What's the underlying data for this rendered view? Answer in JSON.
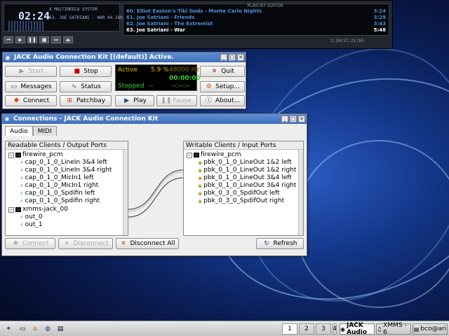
{
  "xmms": {
    "time": "02:24",
    "ticker": "X MULTIMEDIA SYSTEM",
    "info": "63. JOE SATRIANI - WAR   44.1kHz",
    "playlist_header": "PLAYLIST EDITOR",
    "tracks": [
      {
        "title": "60. Elliot Easton's Tiki Gods - Monte Carlo Nights",
        "time": "3:24"
      },
      {
        "title": "61. Joe Satriani - Friends",
        "time": "3:29"
      },
      {
        "title": "62. Joe Satriani - The Extremist",
        "time": "3:43"
      },
      {
        "title": "63. Joe Satriani - War",
        "time": "5:48"
      }
    ],
    "footer": "2:24/17:21:55"
  },
  "jack": {
    "title": "JACK Audio Connection Kit [(default)] Active.",
    "buttons": {
      "start": "Start",
      "stop": "Stop",
      "quit": "Quit",
      "messages": "Messages",
      "status": "Status",
      "setup": "Setup...",
      "connect": "Connect",
      "patchbay": "Patchbay",
      "play": "Play",
      "pause": "Pause",
      "about": "About..."
    },
    "status": {
      "state": "Active",
      "load": "5.9 %",
      "rate": "48000 Hz",
      "time": "00:00:00",
      "transport": "Stopped",
      "dash1": "--",
      "dash2": "--:--:--"
    }
  },
  "connections": {
    "title": "Connections - JACK Audio Connection Kit",
    "tabs": [
      "Audio",
      "MIDI"
    ],
    "readable_header": "Readable Clients / Output Ports",
    "writable_header": "Writable Clients / Input Ports",
    "readable": {
      "client1": "firewire_pcm",
      "ports1": [
        "cap_0_1_0_LineIn 3&4 left",
        "cap_0_1_0_LineIn 3&4 right",
        "cap_0_1_0_MicIn1 left",
        "cap_0_1_0_MicIn1 right",
        "cap_0_1_0_Spdifin left",
        "cap_0_1_0_Spdifin right"
      ],
      "client2": "xmms-jack_00",
      "ports2": [
        "out_0",
        "out_1"
      ]
    },
    "writable": {
      "client1": "firewire_pcm",
      "ports1": [
        "pbk_0_1_0_LineOut 1&2 left",
        "pbk_0_1_0_LineOut 1&2 right",
        "pbk_0_1_0_LineOut 3&4 left",
        "pbk_0_1_0_LineOut 3&4 right",
        "pbk_0_3_0_SpdifOut left",
        "pbk_0_3_0_SpdifOut right"
      ]
    },
    "buttons": {
      "connect": "Connect",
      "disconnect": "Disconnect",
      "disconnect_all": "Disconnect All",
      "refresh": "Refresh"
    }
  },
  "taskbar": {
    "desktops": [
      "1",
      "2",
      "3",
      "4"
    ],
    "tasks": [
      "JACK Audio",
      "XMMS - 6",
      "bco@ari"
    ]
  }
}
